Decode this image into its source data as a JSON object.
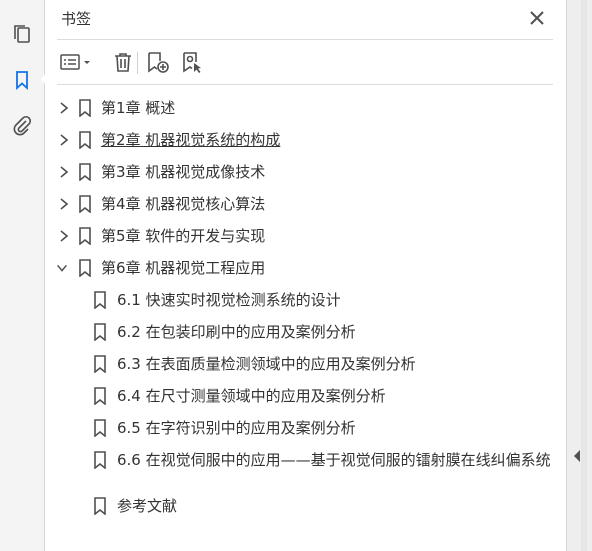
{
  "panel": {
    "title": "书签"
  },
  "icons": {
    "rail": [
      "pages-icon",
      "bookmark-icon",
      "attachment-icon"
    ],
    "toolbar": [
      "options-menu-icon",
      "chevron-down-icon",
      "delete-icon",
      "new-bookmark-icon",
      "bookmark-from-structure-icon"
    ],
    "close": "close-icon"
  },
  "colors": {
    "accent": "#1473e6",
    "text": "#333333",
    "icon": "#505050"
  },
  "bookmarks": [
    {
      "label": "第1章  概述",
      "expanded": false,
      "level": 0
    },
    {
      "label": "第2章  机器视觉系统的构成",
      "expanded": false,
      "level": 0,
      "hover": true
    },
    {
      "label": "第3章  机器视觉成像技术",
      "expanded": false,
      "level": 0
    },
    {
      "label": "第4章  机器视觉核心算法",
      "expanded": false,
      "level": 0
    },
    {
      "label": "第5章  软件的开发与实现",
      "expanded": false,
      "level": 0
    },
    {
      "label": "第6章  机器视觉工程应用",
      "expanded": true,
      "level": 0
    },
    {
      "label": "6.1  快速实时视觉检测系统的设计",
      "level": 1
    },
    {
      "label": "6.2  在包装印刷中的应用及案例分析",
      "level": 1
    },
    {
      "label": "6.3  在表面质量检测领域中的应用及案例分析",
      "level": 1
    },
    {
      "label": "6.4  在尺寸测量领域中的应用及案例分析",
      "level": 1
    },
    {
      "label": "6.5  在字符识别中的应用及案例分析",
      "level": 1
    },
    {
      "label": "6.6  在视觉伺服中的应用——基于视觉伺服的镭射膜在线纠偏系统",
      "level": 1,
      "wrap": true
    },
    {
      "label": "参考文献",
      "level": 1
    }
  ]
}
